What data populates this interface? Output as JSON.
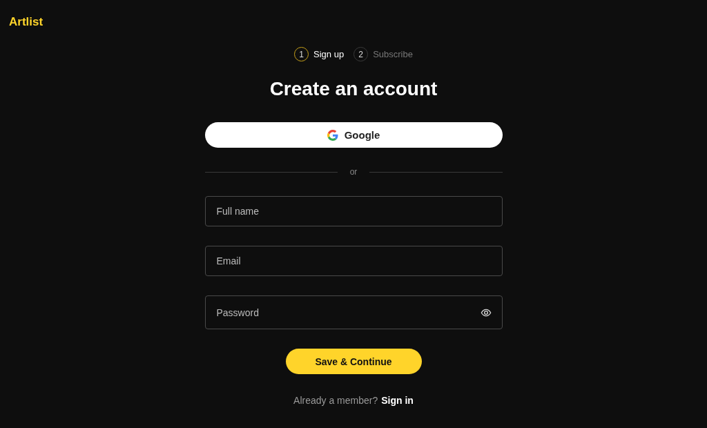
{
  "logo": "Artlist",
  "steps": [
    {
      "number": "1",
      "label": "Sign up",
      "selected": true
    },
    {
      "number": "2",
      "label": "Subscribe",
      "selected": false
    }
  ],
  "title": "Create an account",
  "google_button": "Google",
  "divider": "or",
  "fields": [
    {
      "kind": "text",
      "placeholder": "Full name"
    },
    {
      "kind": "text",
      "placeholder": "Email"
    },
    {
      "kind": "password",
      "placeholder": "Password"
    }
  ],
  "submit": "Save & Continue",
  "footer": {
    "text": "Already a member?",
    "link": "Sign in"
  }
}
